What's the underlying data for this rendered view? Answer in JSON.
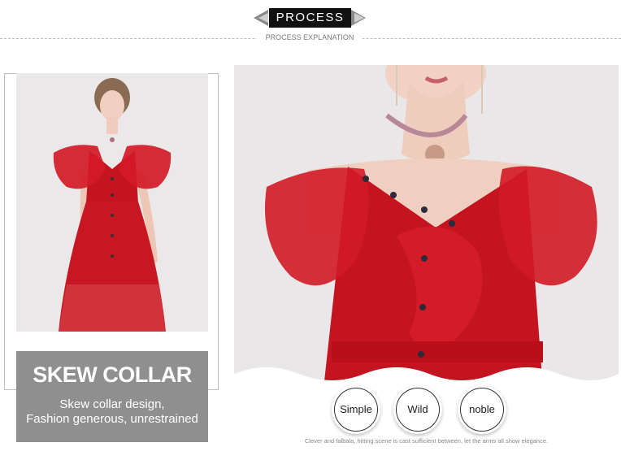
{
  "header": {
    "title": "PROCESS",
    "subtitle": "PROCESS EXPLANATION"
  },
  "feature": {
    "title": "SKEW COLLAR",
    "line1": "Skew collar design,",
    "line2": "Fashion generous, unrestrained"
  },
  "tags": [
    {
      "label": "Simple"
    },
    {
      "label": "Wild"
    },
    {
      "label": "noble"
    }
  ],
  "caption": "Clever and falbala, hitting scene is cast sufficient between, let the arms all show elegance.",
  "colors": {
    "dress_red": "#c4141f",
    "header_bg": "#111111",
    "feature_bg": "#8f8f8f"
  }
}
